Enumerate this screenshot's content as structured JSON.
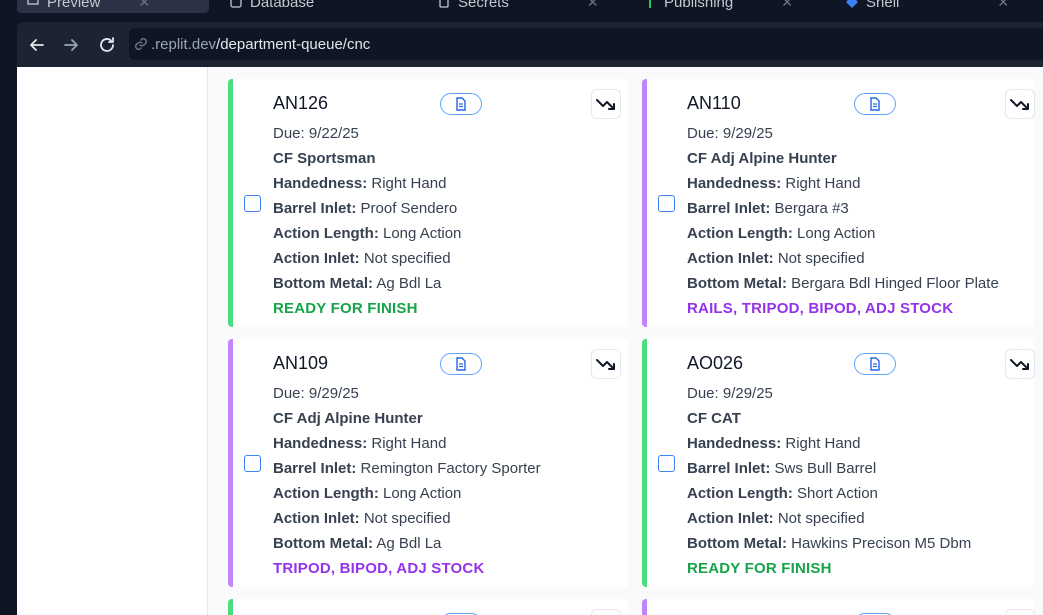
{
  "ide_tabs": [
    {
      "label": "Preview"
    },
    {
      "label": "Database"
    },
    {
      "label": "Secrets"
    },
    {
      "label": "Publishing"
    },
    {
      "label": "Shell"
    }
  ],
  "browser": {
    "url_host": ".replit.dev",
    "url_path": "/department-queue/cnc"
  },
  "cards": [
    {
      "id": "AN126",
      "due": "Due: 9/22/25",
      "model": "CF Sportsman",
      "handedness": "Right Hand",
      "barrel_inlet": "Proof Sendero",
      "action_length": "Long Action",
      "action_inlet": "Not specified",
      "bottom_metal": "Ag Bdl La",
      "status": "READY FOR FINISH",
      "accent": "#4ade80"
    },
    {
      "id": "AN110",
      "due": "Due: 9/29/25",
      "model": "CF Adj Alpine Hunter",
      "handedness": "Right Hand",
      "barrel_inlet": "Bergara #3",
      "action_length": "Long Action",
      "action_inlet": "Not specified",
      "bottom_metal": "Bergara Bdl Hinged Floor Plate",
      "status": "RAILS, TRIPOD, BIPOD, ADJ STOCK",
      "accent": "#c084fc"
    },
    {
      "id": "AN109",
      "due": "Due: 9/29/25",
      "model": "CF Adj Alpine Hunter",
      "handedness": "Right Hand",
      "barrel_inlet": "Remington Factory Sporter",
      "action_length": "Long Action",
      "action_inlet": "Not specified",
      "bottom_metal": "Ag Bdl La",
      "status": "TRIPOD, BIPOD, ADJ STOCK",
      "accent": "#c084fc"
    },
    {
      "id": "AO026",
      "due": "Due: 9/29/25",
      "model": "CF CAT",
      "handedness": "Right Hand",
      "barrel_inlet": "Sws Bull Barrel",
      "action_length": "Short Action",
      "action_inlet": "Not specified",
      "bottom_metal": "Hawkins Precison M5 Dbm",
      "status": "READY FOR FINISH",
      "accent": "#4ade80"
    }
  ],
  "field_labels": {
    "handedness": "Handedness:",
    "barrel_inlet": "Barrel Inlet:",
    "action_length": "Action Length:",
    "action_inlet": "Action Inlet:",
    "bottom_metal": "Bottom Metal:"
  },
  "icons": {
    "document": "document-icon",
    "move": "trending-down-icon",
    "back": "arrow-left-icon",
    "forward": "arrow-right-icon",
    "reload": "reload-icon",
    "link": "link-icon"
  }
}
